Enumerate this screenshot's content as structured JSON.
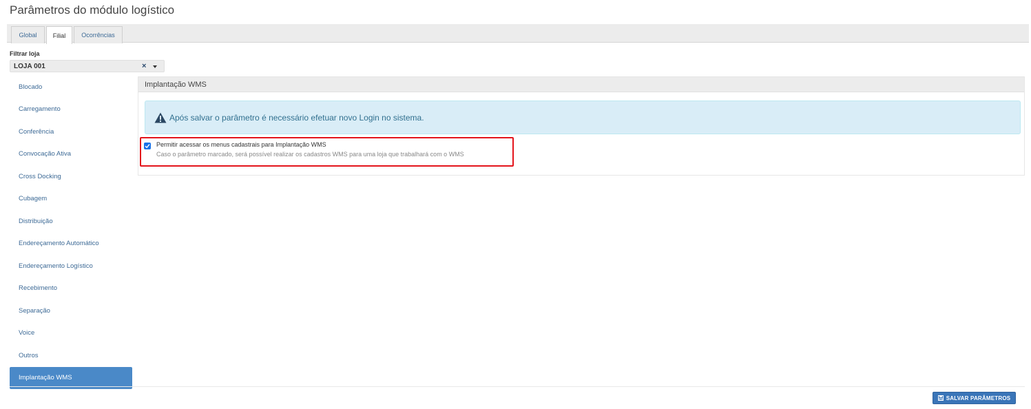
{
  "page": {
    "title": "Parâmetros do módulo logístico"
  },
  "tabs": [
    {
      "label": "Global"
    },
    {
      "label": "Filial"
    },
    {
      "label": "Ocorrências"
    }
  ],
  "filter": {
    "label": "Filtrar loja",
    "value": "LOJA 001",
    "clear_icon": "×"
  },
  "sidebar": {
    "items": [
      {
        "label": "Blocado"
      },
      {
        "label": "Carregamento"
      },
      {
        "label": "Conferência"
      },
      {
        "label": "Convocação Ativa"
      },
      {
        "label": "Cross Docking"
      },
      {
        "label": "Cubagem"
      },
      {
        "label": "Distribuição"
      },
      {
        "label": "Endereçamento Automático"
      },
      {
        "label": "Endereçamento Logístico"
      },
      {
        "label": "Recebimento"
      },
      {
        "label": "Separação"
      },
      {
        "label": "Voice"
      },
      {
        "label": "Outros"
      },
      {
        "label": "Implantação WMS"
      }
    ],
    "active_index": 13
  },
  "panel": {
    "header": "Implantação WMS",
    "alert": {
      "icon": "warning-icon",
      "text": "Após salvar o parâmetro é necessário efetuar novo Login no sistema."
    },
    "option": {
      "checked": true,
      "title": "Permitir acessar os menus cadastrais para Implantação WMS",
      "description": "Caso o parâmetro marcado, será possível realizar os cadastros WMS para uma loja que trabalhará com o WMS"
    }
  },
  "footer": {
    "save_label": "SALVAR PARÂMETROS",
    "save_icon": "floppy-disk-icon"
  },
  "colors": {
    "accent": "#4a89c8",
    "alert_bg": "#d9edf7",
    "alert_text": "#31708f",
    "highlight": "#e3141b",
    "button": "#3a75b8"
  }
}
